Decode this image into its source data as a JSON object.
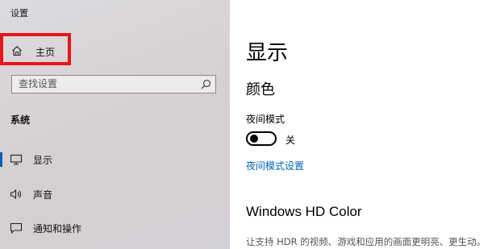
{
  "window": {
    "title": "设置"
  },
  "sidebar": {
    "home_label": "主页",
    "home_icon": "home-icon",
    "search": {
      "placeholder": "查找设置",
      "icon": "search-icon"
    },
    "section_title": "系统",
    "items": [
      {
        "label": "显示",
        "icon": "monitor-icon",
        "selected": true
      },
      {
        "label": "声音",
        "icon": "speaker-icon",
        "selected": false
      },
      {
        "label": "通知和操作",
        "icon": "notification-icon",
        "selected": false
      }
    ]
  },
  "main": {
    "page_title": "显示",
    "color_section": "颜色",
    "night_mode": {
      "label": "夜间模式",
      "state": "关",
      "on": false
    },
    "night_link": "夜间模式设置",
    "hd_title": "Windows HD Color",
    "hd_desc": "让支持 HDR 的视频、游戏和应用的画面更明亮、更生动。"
  },
  "colors": {
    "accent": "#0063b1",
    "link": "#0066b4",
    "highlight_border": "#e8141c"
  }
}
